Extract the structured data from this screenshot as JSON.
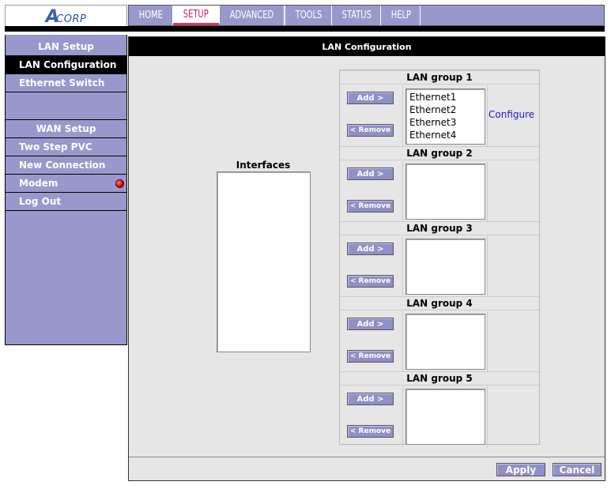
{
  "brand": {
    "logo_text": "CORP",
    "logo_mark": "A"
  },
  "topnav": {
    "tabs": [
      {
        "label": "HOME",
        "active": false
      },
      {
        "label": "SETUP",
        "active": true
      },
      {
        "label": "ADVANCED",
        "active": false
      },
      {
        "label": "TOOLS",
        "active": false
      },
      {
        "label": "STATUS",
        "active": false
      },
      {
        "label": "HELP",
        "active": false
      }
    ]
  },
  "sidebar": {
    "lan_header": "LAN Setup",
    "items_lan": [
      "LAN Configuration",
      "Ethernet Switch"
    ],
    "wan_header": "WAN Setup",
    "items_wan": [
      "Two Step PVC",
      "New Connection",
      "Modem",
      "Log Out"
    ],
    "active": "LAN Configuration",
    "modem_status_color": "#d00000"
  },
  "main": {
    "title": "LAN Configuration",
    "interfaces_label": "Interfaces",
    "configure_link": "Configure",
    "add_label": "Add >",
    "remove_label": "< Remove",
    "groups": [
      {
        "label": "LAN group 1",
        "members": [
          "Ethernet1",
          "Ethernet2",
          "Ethernet3",
          "Ethernet4"
        ]
      },
      {
        "label": "LAN group 2",
        "members": []
      },
      {
        "label": "LAN group 3",
        "members": []
      },
      {
        "label": "LAN group 4",
        "members": []
      },
      {
        "label": "LAN group 5",
        "members": []
      }
    ],
    "apply_label": "Apply",
    "cancel_label": "Cancel"
  }
}
